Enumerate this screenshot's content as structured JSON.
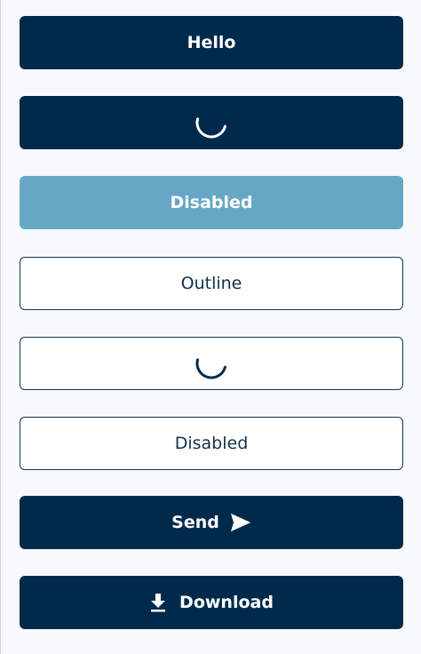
{
  "buttons": {
    "hello": {
      "label": "Hello"
    },
    "loading_solid": {
      "icon": "spinner-icon"
    },
    "disabled_solid": {
      "label": "Disabled"
    },
    "outline": {
      "label": "Outline"
    },
    "loading_outline": {
      "icon": "spinner-icon"
    },
    "disabled_outline": {
      "label": "Disabled"
    },
    "send": {
      "label": "Send",
      "icon": "send-icon"
    },
    "download": {
      "label": "Download",
      "icon": "download-icon"
    }
  },
  "colors": {
    "primary": "#002a4c",
    "primary_disabled": "#66a7c5",
    "outline_border": "#0e3556",
    "background": "#f8f9fa",
    "on_primary": "#ffffff"
  }
}
